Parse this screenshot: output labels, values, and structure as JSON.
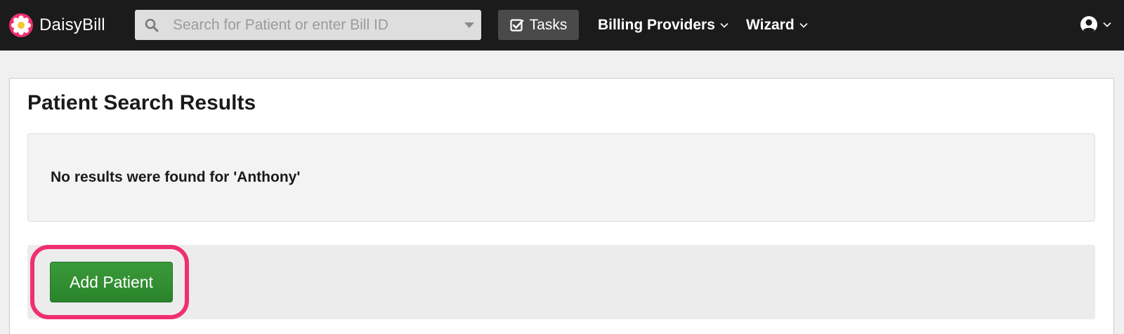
{
  "app": {
    "brand": "DaisyBill",
    "logo_icon": "daisy-logo-icon",
    "colors": {
      "navbar_bg": "#1b1b1b",
      "logo_pink": "#f0306e",
      "add_button_green": "#2e8b2e",
      "highlight_pink": "#f0306e"
    }
  },
  "navbar": {
    "search": {
      "placeholder": "Search for Patient or enter Bill ID",
      "value": "",
      "icon": "search-icon",
      "dropdown_icon": "caret-down-icon"
    },
    "tasks": {
      "label": "Tasks",
      "icon": "checkbox-icon"
    },
    "items": [
      {
        "label": "Billing Providers",
        "icon": "chevron-down-icon"
      },
      {
        "label": "Wizard",
        "icon": "chevron-down-icon"
      }
    ],
    "user_menu": {
      "icon": "user-circle-icon",
      "dropdown_icon": "chevron-down-icon"
    }
  },
  "main": {
    "title": "Patient Search Results",
    "no_results_message": "No results were found for 'Anthony'",
    "add_patient_label": "Add Patient"
  }
}
